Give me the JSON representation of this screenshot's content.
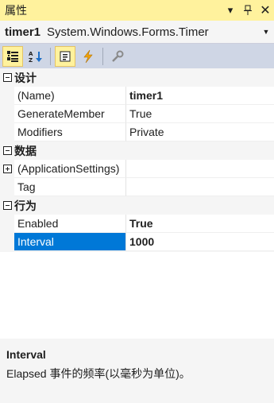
{
  "window": {
    "title": "属性",
    "buttons": [
      "dropdown-icon",
      "pin-icon",
      "close-icon"
    ]
  },
  "object_selector": {
    "name": "timer1",
    "type": "System.Windows.Forms.Timer"
  },
  "toolbar": {
    "items": [
      {
        "name": "categorized-icon",
        "active": true
      },
      {
        "name": "alphabetical-icon",
        "active": false
      },
      {
        "name": "properties-icon",
        "active": true
      },
      {
        "name": "events-icon",
        "active": false
      },
      {
        "name": "property-pages-icon",
        "active": false
      }
    ]
  },
  "categories": [
    {
      "label": "设计",
      "rows": [
        {
          "name": "(Name)",
          "value": "timer1",
          "bold": true
        },
        {
          "name": "GenerateMember",
          "value": "True",
          "bold": false
        },
        {
          "name": "Modifiers",
          "value": "Private",
          "bold": false
        }
      ]
    },
    {
      "label": "数据",
      "rows": [
        {
          "name": "(ApplicationSettings)",
          "value": "",
          "bold": false,
          "expandable": true
        },
        {
          "name": "Tag",
          "value": "",
          "bold": false
        }
      ]
    },
    {
      "label": "行为",
      "rows": [
        {
          "name": "Enabled",
          "value": "True",
          "bold": true
        },
        {
          "name": "Interval",
          "value": "1000",
          "bold": true,
          "selected": true
        }
      ]
    }
  ],
  "description": {
    "title": "Interval",
    "text": "Elapsed 事件的频率(以毫秒为单位)。"
  },
  "colors": {
    "titlebar": "#fff29d",
    "toolbar": "#cfd6e5",
    "selection": "#0078d7",
    "events_icon": "#f0a30a"
  }
}
